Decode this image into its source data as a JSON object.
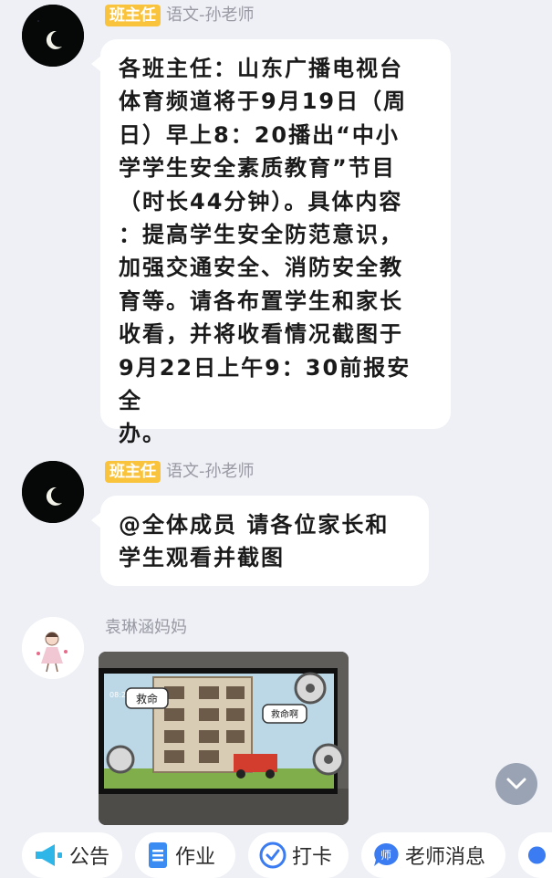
{
  "messages": [
    {
      "role_badge": "班主任",
      "sender": "语文-孙老师",
      "lines": [
        "各班主任：山东广播电视台",
        "体育频道将于9月19日（周",
        "日）早上8：20播出“中小",
        "学学生安全素质教育”节目",
        "（时长44分钟）。具体内容",
        "：提高学生安全防范意识，",
        "加强交通安全、消防安全教",
        "育等。请各布置学生和家长",
        "收看，并将收看情况截图于",
        "9月22日上午9：30前报安全",
        "办。"
      ]
    },
    {
      "role_badge": "班主任",
      "sender": "语文-孙老师",
      "lines": [
        "@全体成员 请各位家长和",
        "学生观看并截图"
      ]
    },
    {
      "sender": "袁琳涵妈妈",
      "photo": {
        "tv_time": "08:21",
        "game_title": "救命",
        "game_button": "救命啊"
      }
    }
  ],
  "toolbar": {
    "items": [
      {
        "label": "公告",
        "icon": "megaphone-icon"
      },
      {
        "label": "作业",
        "icon": "document-icon"
      },
      {
        "label": "打卡",
        "icon": "check-circle-icon"
      },
      {
        "label": "老师消息",
        "icon": "teacher-message-icon"
      }
    ]
  },
  "colors": {
    "background": "#eef0f6",
    "badge": "#f9c33c",
    "accent_blue": "#2f7bf5"
  }
}
